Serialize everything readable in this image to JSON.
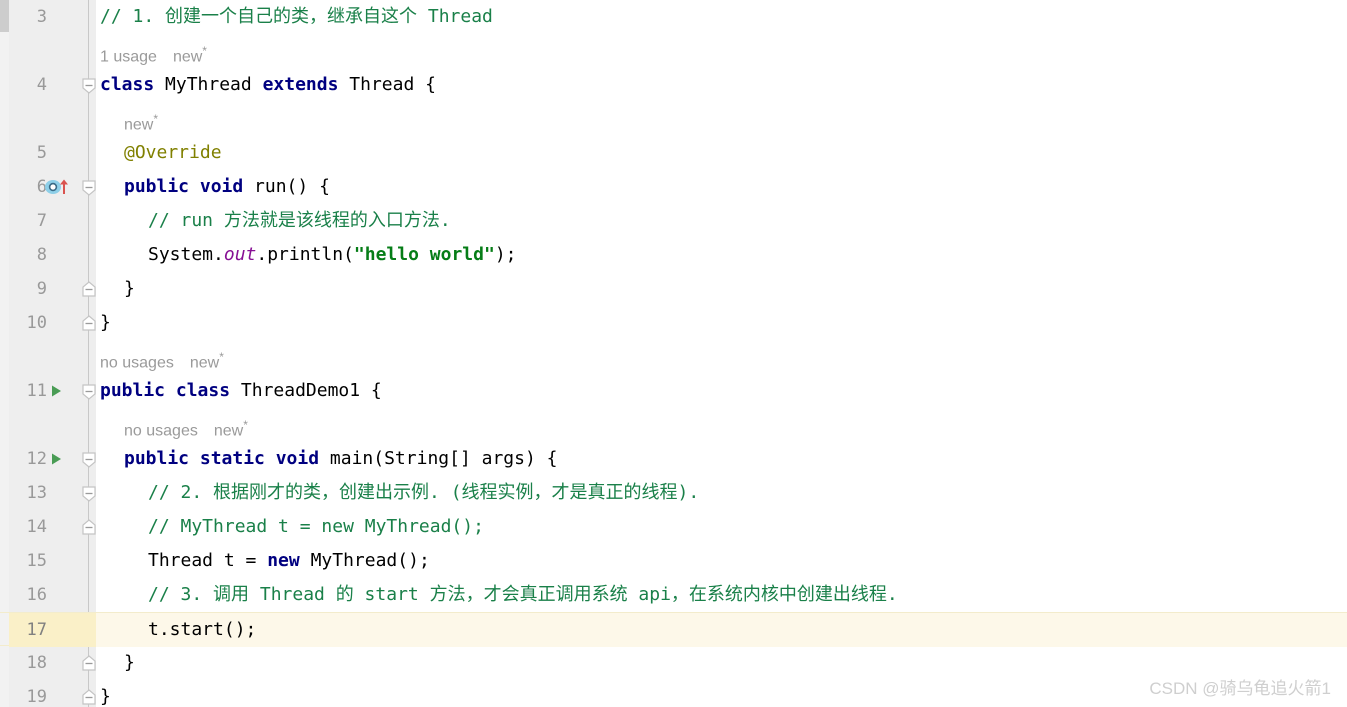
{
  "editor": {
    "language": "java",
    "caret_line": 17,
    "colors": {
      "background": "#ffffff",
      "gutter_background": "#eeeeee",
      "caret_line_background": "#fdf8e9",
      "keyword": "#000080",
      "comment": "#1a8049",
      "string": "#067d17",
      "annotation": "#808000",
      "static_field": "#871094",
      "line_number": "#999999",
      "inlay_hint": "#9a9a9a",
      "run_marker": "#499c54",
      "override_marker": "#62b8de",
      "watermark": "#cfcfcf"
    }
  },
  "lines": [
    {
      "number": "3",
      "type": "code",
      "gutter": {
        "run": false,
        "override": false,
        "fold": "none"
      },
      "indent": 0,
      "tokens": [
        {
          "text": "// 1. 创建一个自己的类，继承自这个 Thread",
          "style": "comment"
        }
      ]
    },
    {
      "number": "",
      "type": "hint",
      "gutter": {
        "run": false,
        "override": false,
        "fold": "none"
      },
      "indent": 0,
      "hint_text": "1 usage",
      "hint_new": "new"
    },
    {
      "number": "4",
      "type": "code",
      "gutter": {
        "run": false,
        "override": false,
        "fold": "open"
      },
      "indent": 0,
      "tokens": [
        {
          "text": "class ",
          "style": "keyword"
        },
        {
          "text": "MyThread ",
          "style": "plain"
        },
        {
          "text": "extends ",
          "style": "keyword"
        },
        {
          "text": "Thread {",
          "style": "plain"
        }
      ]
    },
    {
      "number": "",
      "type": "hint",
      "gutter": {
        "run": false,
        "override": false,
        "fold": "none"
      },
      "indent": 4,
      "hint_text": "",
      "hint_new": "new"
    },
    {
      "number": "5",
      "type": "code",
      "gutter": {
        "run": false,
        "override": false,
        "fold": "none"
      },
      "indent": 4,
      "tokens": [
        {
          "text": "@Override",
          "style": "annotation"
        }
      ]
    },
    {
      "number": "6",
      "type": "code",
      "gutter": {
        "run": false,
        "override": true,
        "fold": "open"
      },
      "indent": 4,
      "tokens": [
        {
          "text": "public void ",
          "style": "keyword"
        },
        {
          "text": "run() {",
          "style": "plain"
        }
      ]
    },
    {
      "number": "7",
      "type": "code",
      "gutter": {
        "run": false,
        "override": false,
        "fold": "none"
      },
      "indent": 8,
      "tokens": [
        {
          "text": "// run 方法就是该线程的入口方法.",
          "style": "comment"
        }
      ]
    },
    {
      "number": "8",
      "type": "code",
      "gutter": {
        "run": false,
        "override": false,
        "fold": "none"
      },
      "indent": 8,
      "tokens": [
        {
          "text": "System.",
          "style": "plain"
        },
        {
          "text": "out",
          "style": "static_field"
        },
        {
          "text": ".println(",
          "style": "plain"
        },
        {
          "text": "\"hello world\"",
          "style": "string"
        },
        {
          "text": ");",
          "style": "plain"
        }
      ]
    },
    {
      "number": "9",
      "type": "code",
      "gutter": {
        "run": false,
        "override": false,
        "fold": "close"
      },
      "indent": 4,
      "tokens": [
        {
          "text": "}",
          "style": "plain"
        }
      ]
    },
    {
      "number": "10",
      "type": "code",
      "gutter": {
        "run": false,
        "override": false,
        "fold": "close"
      },
      "indent": 0,
      "tokens": [
        {
          "text": "}",
          "style": "plain"
        }
      ]
    },
    {
      "number": "",
      "type": "hint",
      "gutter": {
        "run": false,
        "override": false,
        "fold": "none"
      },
      "indent": 0,
      "hint_text": "no usages",
      "hint_new": "new"
    },
    {
      "number": "11",
      "type": "code",
      "gutter": {
        "run": true,
        "override": false,
        "fold": "open"
      },
      "indent": 0,
      "tokens": [
        {
          "text": "public class ",
          "style": "keyword"
        },
        {
          "text": "ThreadDemo1 {",
          "style": "plain"
        }
      ]
    },
    {
      "number": "",
      "type": "hint",
      "gutter": {
        "run": false,
        "override": false,
        "fold": "none"
      },
      "indent": 4,
      "hint_text": "no usages",
      "hint_new": "new"
    },
    {
      "number": "12",
      "type": "code",
      "gutter": {
        "run": true,
        "override": false,
        "fold": "open"
      },
      "indent": 4,
      "tokens": [
        {
          "text": "public static void ",
          "style": "keyword"
        },
        {
          "text": "main(String[] args) {",
          "style": "plain"
        }
      ]
    },
    {
      "number": "13",
      "type": "code",
      "gutter": {
        "run": false,
        "override": false,
        "fold": "open"
      },
      "indent": 8,
      "tokens": [
        {
          "text": "// 2. 根据刚才的类，创建出示例. (线程实例，才是真正的线程).",
          "style": "comment"
        }
      ]
    },
    {
      "number": "14",
      "type": "code",
      "gutter": {
        "run": false,
        "override": false,
        "fold": "close"
      },
      "indent": 8,
      "tokens": [
        {
          "text": "// MyThread t = new MyThread();",
          "style": "comment"
        }
      ]
    },
    {
      "number": "15",
      "type": "code",
      "gutter": {
        "run": false,
        "override": false,
        "fold": "none"
      },
      "indent": 8,
      "tokens": [
        {
          "text": "Thread t = ",
          "style": "plain"
        },
        {
          "text": "new ",
          "style": "keyword"
        },
        {
          "text": "MyThread();",
          "style": "plain"
        }
      ]
    },
    {
      "number": "16",
      "type": "code",
      "gutter": {
        "run": false,
        "override": false,
        "fold": "none"
      },
      "indent": 8,
      "tokens": [
        {
          "text": "// 3. 调用 Thread 的 start 方法，才会真正调用系统 api，在系统内核中创建出线程.",
          "style": "comment"
        }
      ]
    },
    {
      "number": "17",
      "type": "code",
      "caret": true,
      "gutter": {
        "run": false,
        "override": false,
        "fold": "none"
      },
      "indent": 8,
      "tokens": [
        {
          "text": "t.start();",
          "style": "plain"
        }
      ]
    },
    {
      "number": "18",
      "type": "code",
      "gutter": {
        "run": false,
        "override": false,
        "fold": "close"
      },
      "indent": 4,
      "tokens": [
        {
          "text": "}",
          "style": "plain"
        }
      ]
    },
    {
      "number": "19",
      "type": "code",
      "gutter": {
        "run": false,
        "override": false,
        "fold": "close"
      },
      "indent": 0,
      "tokens": [
        {
          "text": "}",
          "style": "plain"
        }
      ]
    }
  ],
  "watermark": "CSDN @骑乌龟追火箭1"
}
